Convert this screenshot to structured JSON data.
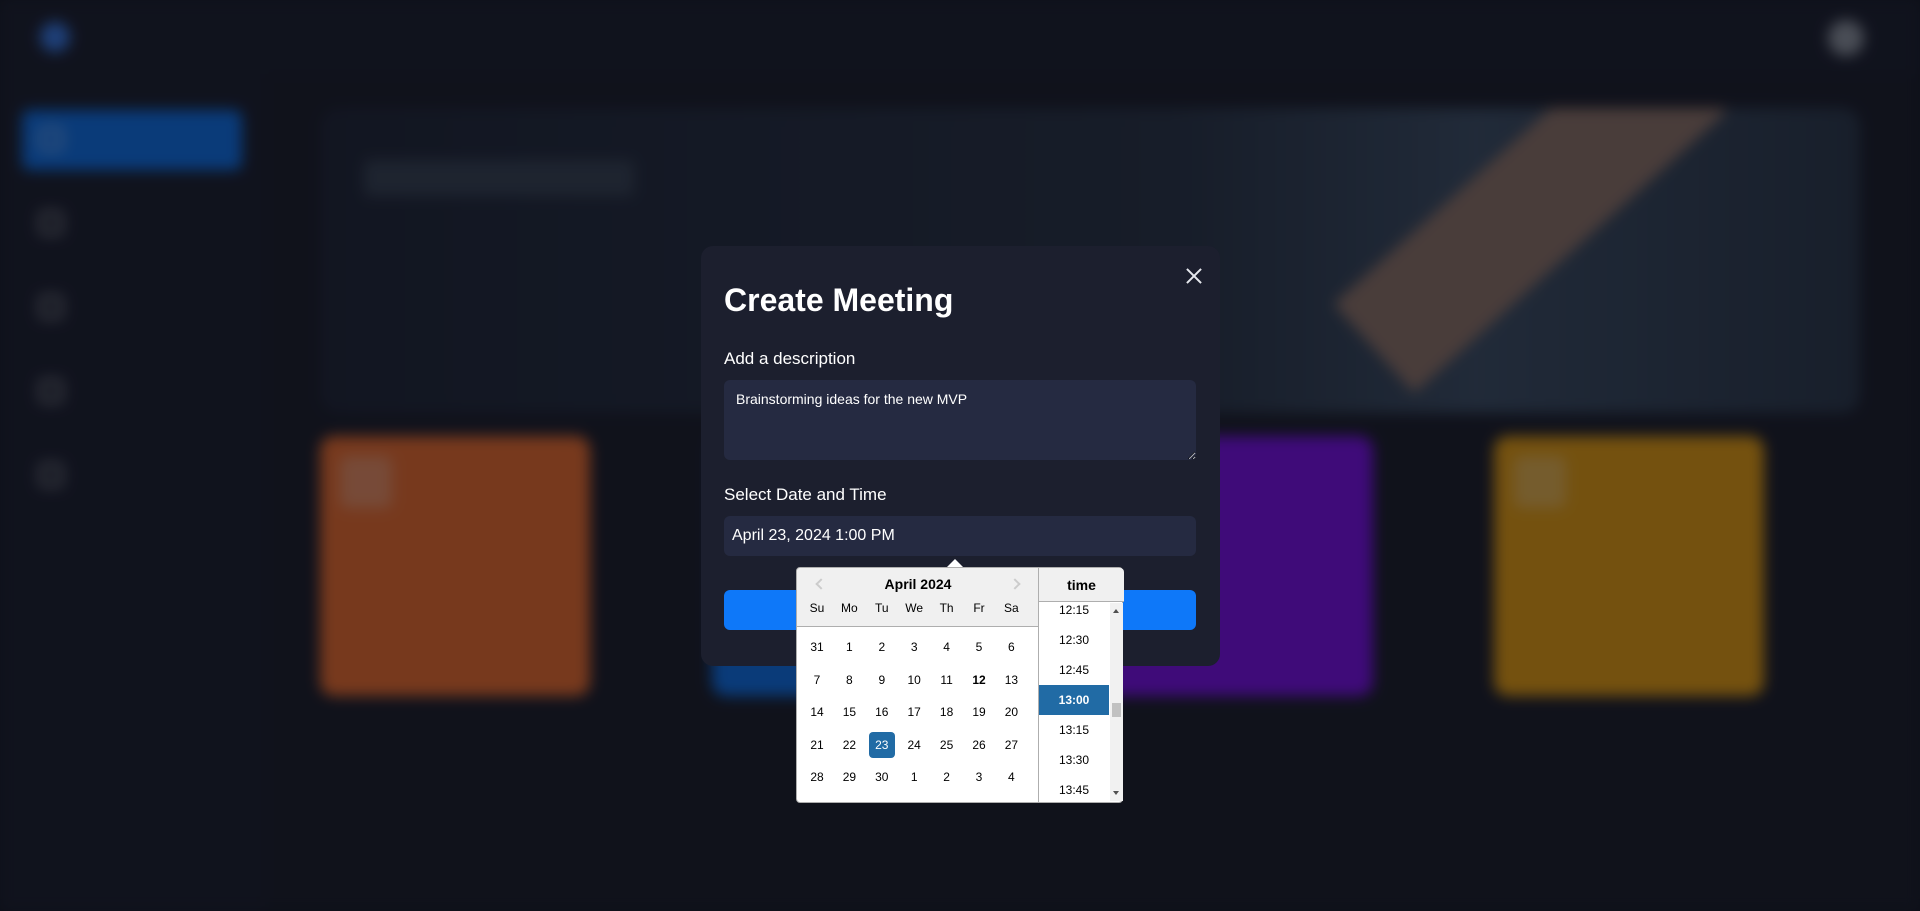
{
  "modal": {
    "title": "Create Meeting",
    "description_label": "Add a description",
    "description_value": "Brainstorming ideas for the new MVP",
    "datetime_label": "Select Date and Time",
    "datetime_value": "April 23, 2024 1:00 PM",
    "close_icon": "close-icon",
    "submit_color": "#0e78f9"
  },
  "datepicker": {
    "month_title": "April 2024",
    "weekdays": [
      "Su",
      "Mo",
      "Tu",
      "We",
      "Th",
      "Fr",
      "Sa"
    ],
    "weeks": [
      [
        "31",
        "1",
        "2",
        "3",
        "4",
        "5",
        "6"
      ],
      [
        "7",
        "8",
        "9",
        "10",
        "11",
        "12",
        "13"
      ],
      [
        "14",
        "15",
        "16",
        "17",
        "18",
        "19",
        "20"
      ],
      [
        "21",
        "22",
        "23",
        "24",
        "25",
        "26",
        "27"
      ],
      [
        "28",
        "29",
        "30",
        "1",
        "2",
        "3",
        "4"
      ]
    ],
    "today": "12",
    "selected": "23",
    "selected_color": "#216ba5",
    "time_header": "time",
    "time_slots": [
      "12:15",
      "12:30",
      "12:45",
      "13:00",
      "13:15",
      "13:30",
      "13:45"
    ],
    "selected_time": "13:00"
  },
  "background": {
    "card_colors": [
      "#ff742e",
      "#0e78f9",
      "#830ef9",
      "#f9a90e"
    ]
  }
}
